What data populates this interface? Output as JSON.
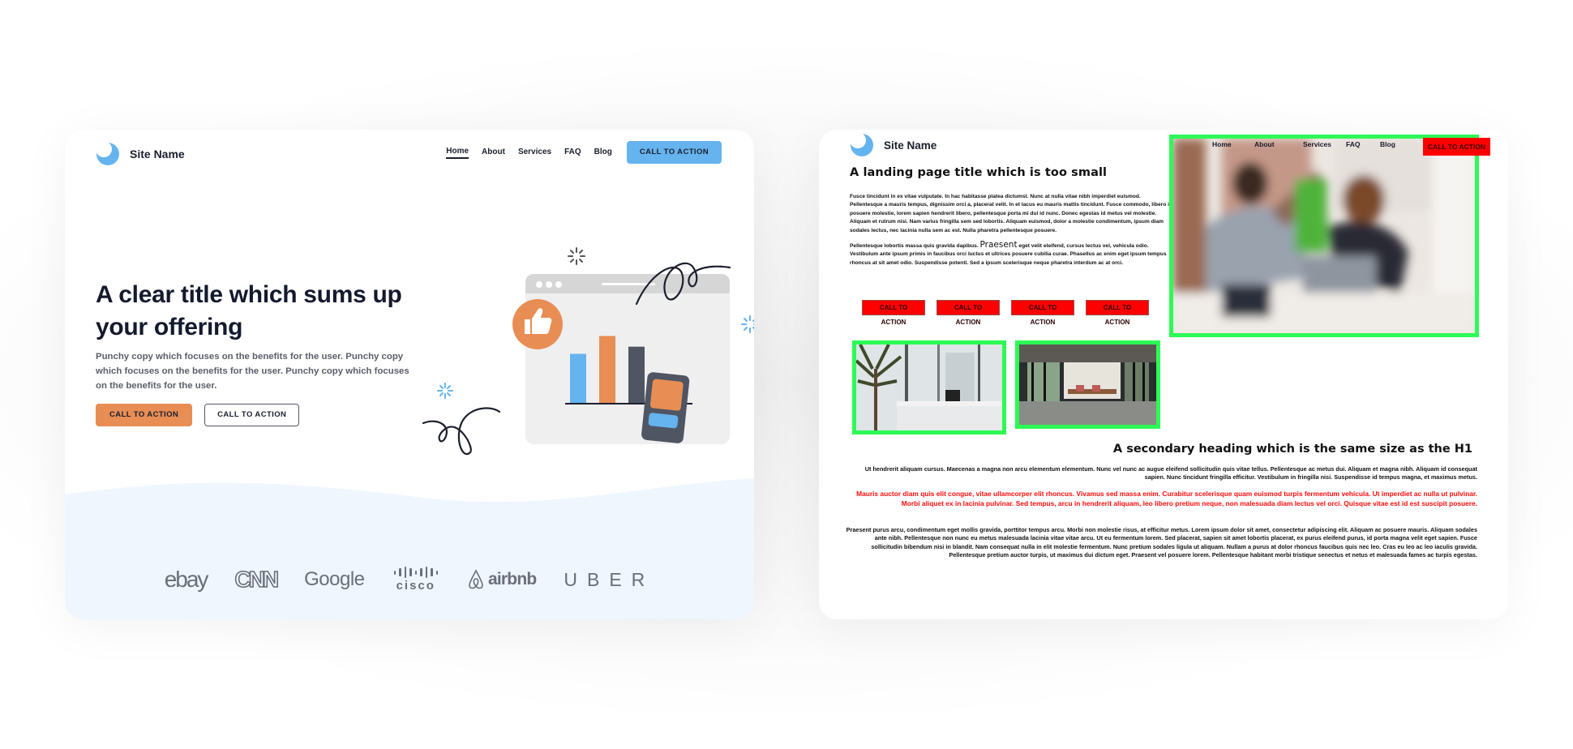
{
  "good_example": {
    "site_name": "Site Name",
    "nav": {
      "items": [
        "Home",
        "About",
        "Services",
        "FAQ",
        "Blog"
      ],
      "active": "Home",
      "cta": "CALL TO ACTION"
    },
    "hero": {
      "title": "A clear title which sums up your offering",
      "copy": "Punchy copy which focuses on the benefits for the user. Punchy copy which focuses on the benefits for the user. Punchy copy which focuses on the benefits for the user.",
      "primary_cta": "CALL TO ACTION",
      "secondary_cta": "CALL TO ACTION"
    },
    "illustration": {
      "icons": [
        "thumbs-up-icon",
        "sparkle-icon",
        "phone-icon",
        "browser-window-icon"
      ],
      "bar_colors": [
        "#65b3ef",
        "#e88d53",
        "#4f5562",
        "#d2d2d2"
      ],
      "bar_levels": [
        0.55,
        0.75,
        0.63,
        0.32
      ]
    },
    "logos": [
      "ebay",
      "CNN",
      "Google",
      "cisco",
      "airbnb",
      "UBER"
    ]
  },
  "bad_example": {
    "site_name": "Site Name",
    "title": "A landing page title which is too small",
    "paragraph1": "Fusce tincidunt in ex vitae vulputate. In hac habitasse platea dictumst. Nunc at nulla vitae nibh imperdiet euismod. Pellentesque a mauris tempus, dignissim orci a, placerat velit. In et lacus eu mauris mattis tincidunt. Fusce commodo, libero id posuere molestie, lorem sapien hendrerit libero, pellentesque porta mi dui id nunc. Donec egestas id metus vel molestie. Aliquam et rutrum nisi. Nam varius fringilla sem sed lobortis. Aliquam euismod, dolor a molestie condimentum, ipsum diam sodales lectus, nec lacinia nulla sem ac est. Nulla pharetra pellentesque posuere.",
    "paragraph2_start": "Pellentesque lobortis massa quis gravida dapibus.",
    "paragraph2_big_word": "Praesent",
    "paragraph2_end": "eget velit eleifend, cursus lectus vel, vehicula odio. Vestibulum ante ipsum primis in faucibus orci luctus et ultrices posuere cubilia curae. Phasellus ac enim eget ipsum tempus rhoncus at sit amet odio. Suspendisse potenti. Sed a ipsum scelerisque neque pharetra interdum ac at orci.",
    "ctas": [
      "CALL TO ACTION",
      "CALL TO ACTION",
      "CALL TO ACTION",
      "CALL TO ACTION"
    ],
    "nav": {
      "items": [
        "Home",
        "About",
        "Services",
        "FAQ",
        "Blog"
      ],
      "cta": "CALL TO ACTION"
    },
    "secondary_heading": "A secondary heading which is the same size as the H1",
    "right_paragraph1": "Ut hendrerit aliquam cursus. Maecenas a magna non arcu elementum elementum. Nunc vel nunc ac augue eleifend sollicitudin quis vitae tellus. Pellentesque ac metus dui. Aliquam et magna nibh. Aliquam id consequat sapien. Nunc tincidunt fringilla efficitur. Vestibulum in fringilla nisi. Suspendisse id tempus magna, et maximus metus.",
    "right_paragraph_red": "Mauris auctor diam quis elit congue, vitae ullamcorper elit rhoncus. Vivamus sed massa enim. Curabitur scelerisque quam euismod turpis fermentum vehicula. Ut imperdiet ac nulla ut pulvinar. Morbi aliquet ex in lacinia pulvinar. Sed tempus, arcu in hendrerit aliquam, leo libero pretium neque, non malesuada diam lectus vel orci. Quisque vitae est id est suscipit posuere.",
    "right_paragraph3": "Praesent purus arcu, condimentum eget mollis gravida, porttitor tempus arcu. Morbi non molestie risus, at efficitur metus. Lorem ipsum dolor sit amet, consectetur adipiscing elit. Aliquam ac posuere mauris. Aliquam sodales ante nibh. Pellentesque non nunc eu metus malesuada lacinia vitae vitae arcu. Ut eu fermentum lorem. Sed placerat, sapien sit amet lobortis placerat, ex purus eleifend purus, id porta magna velit eget sapien. Fusce sollicitudin bibendum nisi in blandit. Nam consequat nulla in elit molestie fermentum. Nunc pretium sodales ligula ut aliquam. Nullam a purus at dolor rhoncus faucibus quis nec leo. Cras eu leo ac leo iaculis gravida. Pellentesque pretium auctor turpis, ut maximus dui dictum eget. Praesent vel posuere lorem. Pellentesque habitant morbi tristique senectus et netus et malesuada fames ac turpis egestas.",
    "images": [
      "high-five-office-photo",
      "plant-window-desk-photo",
      "meeting-room-photo"
    ]
  },
  "colors": {
    "accent_blue": "#65b3ef",
    "accent_orange": "#e88d53",
    "dark_text": "#141a2e",
    "bad_red": "#ff0000",
    "bad_green_border": "#2dfa55",
    "logo_band": "#eff6fd"
  }
}
